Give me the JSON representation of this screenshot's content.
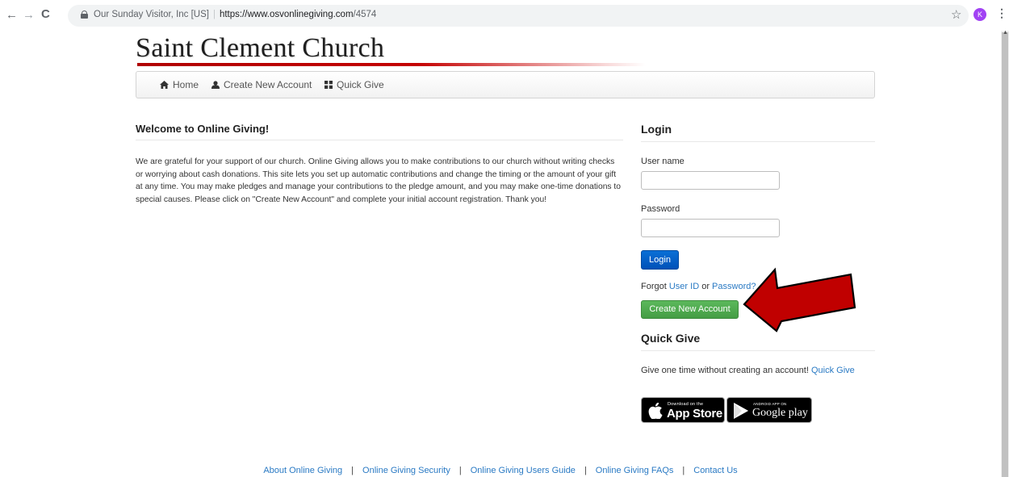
{
  "browser": {
    "site_identity": "Our Sunday Visitor, Inc [US]",
    "url_host": "https://www.osvonlinegiving.com",
    "url_path": "/4574",
    "profile_initial": "K",
    "profile_color": "#a142f4"
  },
  "site": {
    "title": "Saint Clement Church",
    "accent_color": "#c40000"
  },
  "nav": {
    "items": [
      {
        "label": "Home",
        "icon": "home-icon"
      },
      {
        "label": "Create New Account",
        "icon": "user-icon"
      },
      {
        "label": "Quick Give",
        "icon": "grid-icon"
      }
    ]
  },
  "welcome": {
    "heading": "Welcome to Online Giving!",
    "body": "We are grateful for your support of our church. Online Giving allows you to make contributions to our church without writing checks or worrying about cash donations. This site lets you set up automatic contributions and change the timing or the amount of your gift at any time. You may make pledges and manage your contributions to the pledge amount, and you may make one-time donations to special causes. Please click on \"Create New Account\" and complete your initial account registration. Thank you!"
  },
  "login": {
    "heading": "Login",
    "username_label": "User name",
    "username_value": "",
    "password_label": "Password",
    "password_value": "",
    "login_button": "Login",
    "forgot_prefix": "Forgot",
    "forgot_userid": "User ID",
    "forgot_or": "or",
    "forgot_password": "Password?",
    "create_button": "Create New Account"
  },
  "quick_give": {
    "heading": "Quick Give",
    "text": "Give one time without creating an account!",
    "link": "Quick Give"
  },
  "badges": {
    "apple_small": "Download on the",
    "apple_big": "App Store",
    "google_small": "ANDROID APP ON",
    "google_big": "Google play"
  },
  "footer": {
    "links": [
      "About Online Giving",
      "Online Giving Security",
      "Online Giving Users Guide",
      "Online Giving FAQs",
      "Contact Us"
    ],
    "separator": "|"
  },
  "annotation": {
    "arrow_color": "#c00000",
    "points_to": "Create New Account"
  }
}
